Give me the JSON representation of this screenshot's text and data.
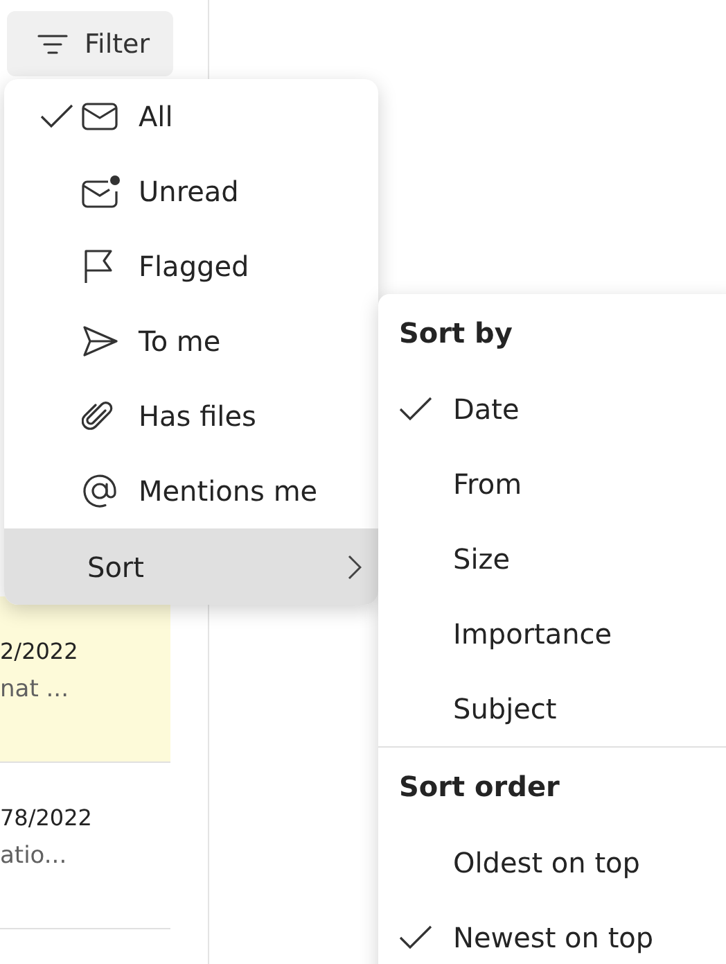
{
  "filter_button": {
    "label": "Filter"
  },
  "mail_rows": [
    {
      "date": "2/2022",
      "preview": "nat ...",
      "highlighted": true
    },
    {
      "date": "78/2022",
      "preview": "atio...",
      "highlighted": false
    }
  ],
  "filter_menu": {
    "items": [
      {
        "label": "All",
        "selected": true,
        "kind": "option"
      },
      {
        "label": "Unread",
        "selected": false,
        "kind": "option"
      },
      {
        "label": "Flagged",
        "selected": false,
        "kind": "option"
      },
      {
        "label": "To me",
        "selected": false,
        "kind": "option"
      },
      {
        "label": "Has files",
        "selected": false,
        "kind": "option"
      },
      {
        "label": "Mentions me",
        "selected": false,
        "kind": "option"
      },
      {
        "label": "Sort",
        "selected": false,
        "kind": "submenu",
        "expanded": true
      }
    ]
  },
  "sort_menu": {
    "sections": [
      {
        "heading": "Sort by",
        "items": [
          {
            "label": "Date",
            "selected": true
          },
          {
            "label": "From",
            "selected": false
          },
          {
            "label": "Size",
            "selected": false
          },
          {
            "label": "Importance",
            "selected": false
          },
          {
            "label": "Subject",
            "selected": false
          }
        ]
      },
      {
        "heading": "Sort order",
        "items": [
          {
            "label": "Oldest on top",
            "selected": false
          },
          {
            "label": "Newest on top",
            "selected": true
          }
        ]
      }
    ]
  }
}
